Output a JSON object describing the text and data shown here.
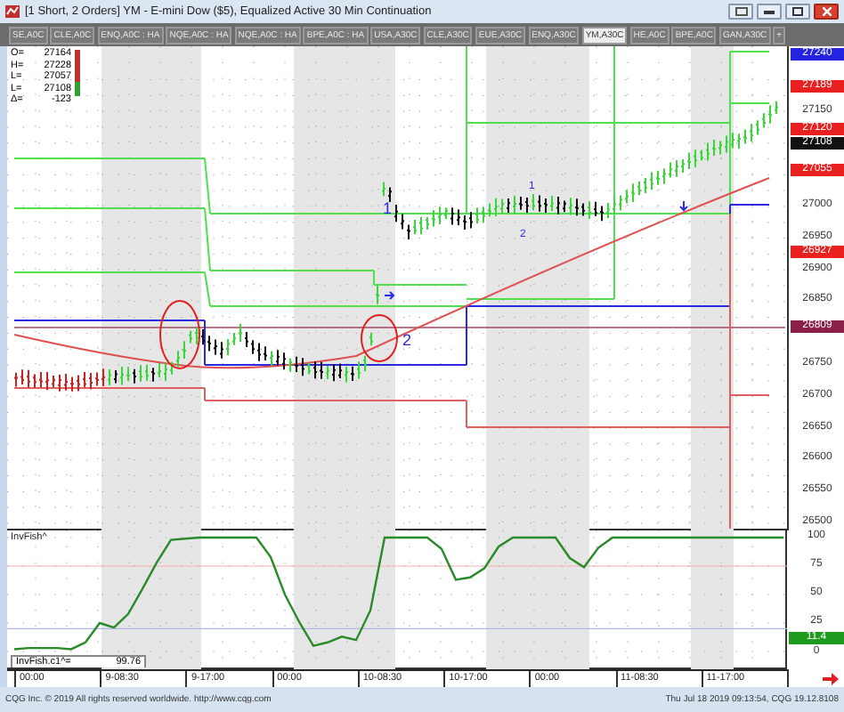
{
  "window": {
    "title": "[1 Short, 2 Orders]  YM - E-mini Dow ($5), Equalized Active 30 Min Continuation"
  },
  "tabs": [
    {
      "label": "SE,A0C",
      "selected": false
    },
    {
      "label": "CLE,A0C",
      "selected": false
    },
    {
      "label": "ENQ,A0C : HA",
      "selected": false
    },
    {
      "label": "NQE,A0C : HA",
      "selected": false
    },
    {
      "label": "NQE,A0C : HA",
      "selected": false
    },
    {
      "label": "BPE,A0C : HA",
      "selected": false
    },
    {
      "label": "USA,A30C",
      "selected": false
    },
    {
      "label": "CLE,A30C",
      "selected": false
    },
    {
      "label": "EUE,A30C",
      "selected": false
    },
    {
      "label": "ENQ,A30C",
      "selected": false
    },
    {
      "label": "YM,A30C",
      "selected": true
    },
    {
      "label": "HE,A0C",
      "selected": false
    },
    {
      "label": "BPE,A0C",
      "selected": false
    },
    {
      "label": "GAN,A30C",
      "selected": false
    }
  ],
  "add_tab": "+",
  "quote": [
    {
      "label": "O=",
      "value": "27164"
    },
    {
      "label": "H=",
      "value": "27228"
    },
    {
      "label": "L=",
      "value": "27057"
    },
    {
      "label": "L=",
      "value": "27108"
    },
    {
      "label": "Δ=",
      "value": "-123"
    }
  ],
  "annotations": [
    {
      "text": "1"
    },
    {
      "text": "2"
    },
    {
      "text": "1"
    },
    {
      "text": "2"
    }
  ],
  "price_axis": [
    {
      "label": "27240",
      "color": "#2424e0"
    },
    {
      "label": "27189",
      "color": "#e82020"
    },
    {
      "label": "27150"
    },
    {
      "label": "27120",
      "color": "#e82020"
    },
    {
      "label": "27108",
      "color": "#111111"
    },
    {
      "label": "27055",
      "color": "#e82020"
    },
    {
      "label": "27000"
    },
    {
      "label": "26950"
    },
    {
      "label": "26927",
      "color": "#e82020"
    },
    {
      "label": "26900"
    },
    {
      "label": "26850"
    },
    {
      "label": "26809",
      "color": "#8a2048"
    },
    {
      "label": "26750"
    },
    {
      "label": "26700"
    },
    {
      "label": "26650"
    },
    {
      "label": "26600"
    },
    {
      "label": "26550"
    },
    {
      "label": "26500"
    }
  ],
  "indicator": {
    "title": "InvFish^",
    "readout_label": "InvFish.c1^=",
    "readout_value": "99.76",
    "last_value": {
      "label": "11.4",
      "color": "#1e9a1e"
    },
    "chart_data": {
      "type": "line",
      "ylim": [
        0,
        100
      ],
      "yticks": [
        100,
        75,
        50,
        25,
        0
      ],
      "grid": true,
      "ref_lines": [
        {
          "axis": "y",
          "value": 75,
          "color": "#f0b0b0"
        },
        {
          "axis": "y",
          "value": 20,
          "color": "#b0b8e8"
        }
      ],
      "series": [
        {
          "color": "#2a8a2a",
          "values": [
            2,
            3,
            3,
            3,
            2,
            8,
            25,
            21,
            33,
            55,
            78,
            98,
            99,
            100,
            100,
            100,
            100,
            100,
            83,
            50,
            26,
            5,
            8,
            13,
            10,
            36,
            100,
            100,
            100,
            100,
            90,
            63,
            65,
            73,
            92,
            100,
            100,
            100,
            100,
            82,
            74,
            91,
            100,
            100,
            100,
            100,
            100,
            100,
            100,
            100,
            100,
            100,
            100,
            100,
            100
          ]
        }
      ]
    }
  },
  "time_axis": [
    "00:00",
    "9-08:30",
    "9-17:00",
    "00:00",
    "10-08:30",
    "10-17:00",
    "00:00",
    "11-08:30",
    "11-17:00"
  ],
  "status_bar": {
    "copyright": "CQG Inc. © 2019 All rights reserved worldwide. http://www.cqg.com",
    "timestamp": "Thu Jul 18 2019 09:13:54, CQG 19.12.8108"
  }
}
